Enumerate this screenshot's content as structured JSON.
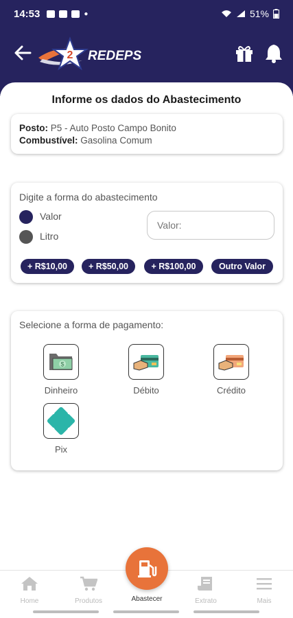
{
  "status_bar": {
    "time": "14:53",
    "battery": "51%"
  },
  "brand": {
    "logo_text": "REDEPS"
  },
  "page": {
    "title": "Informe os dados do Abastecimento"
  },
  "fuel_info": {
    "posto_label": "Posto:",
    "posto_value": "P5 - Auto Posto Campo Bonito",
    "combustivel_label": "Combustível:",
    "combustivel_value": "Gasolina Comum"
  },
  "supply_form": {
    "label": "Digite a forma do abastecimento",
    "options": [
      {
        "label": "Valor",
        "color": "#26235e"
      },
      {
        "label": "Litro",
        "color": "#555555"
      }
    ],
    "value_placeholder": "Valor:",
    "quick_amounts": [
      "+ R$10,00",
      "+ R$50,00",
      "+ R$100,00",
      "Outro Valor"
    ]
  },
  "payment": {
    "label": "Selecione a forma de pagamento:",
    "methods": [
      {
        "label": "Dinheiro",
        "icon": "cash-icon"
      },
      {
        "label": "Débito",
        "icon": "debit-card-icon"
      },
      {
        "label": "Crédito",
        "icon": "credit-card-icon"
      },
      {
        "label": "Pix",
        "icon": "pix-icon"
      }
    ]
  },
  "bottom_nav": {
    "items": [
      {
        "label": "Home",
        "icon": "home-icon"
      },
      {
        "label": "Produtos",
        "icon": "cart-icon"
      },
      {
        "label": "Abastecer",
        "icon": "fuel-pump-icon",
        "active": true
      },
      {
        "label": "Extrato",
        "icon": "receipt-icon"
      },
      {
        "label": "Mais",
        "icon": "menu-icon"
      }
    ]
  },
  "colors": {
    "primary": "#26235e",
    "accent": "#e8733a",
    "pix": "#2bb5a9"
  }
}
